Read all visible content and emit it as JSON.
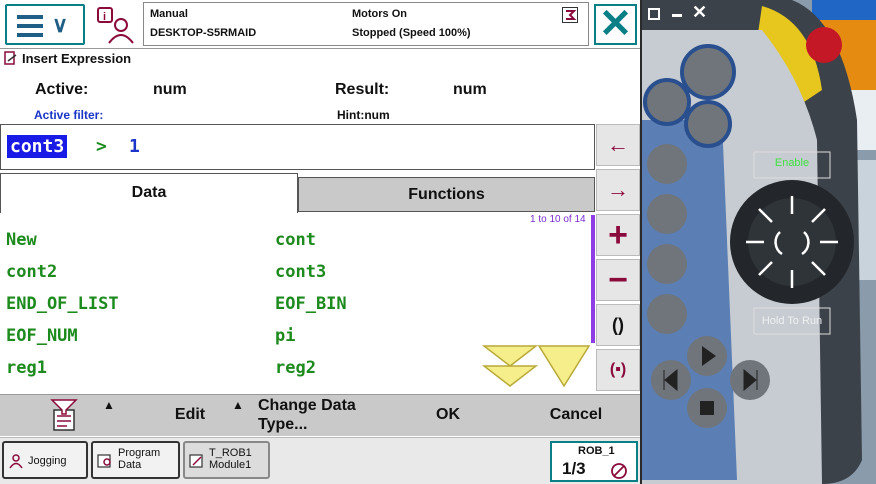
{
  "header": {
    "mode": "Manual",
    "system": "DESKTOP-S5RMAID",
    "motors": "Motors On",
    "state": "Stopped (Speed 100%)"
  },
  "dialog": {
    "title": "Insert Expression",
    "active_label": "Active:",
    "active_value": "num",
    "result_label": "Result:",
    "result_value": "num",
    "filter_label": "Active filter:",
    "hint": "Hint:num"
  },
  "expression": {
    "selected": "cont3",
    "operator": ">",
    "operand": "1"
  },
  "tabs": [
    {
      "label": "Data",
      "active": true
    },
    {
      "label": "Functions",
      "active": false
    }
  ],
  "list": {
    "range": "1 to 10 of 14",
    "items": [
      "New",
      "cont",
      "cont2",
      "cont3",
      "END_OF_LIST",
      "EOF_BIN",
      "EOF_NUM",
      "pi",
      "reg1",
      "reg2"
    ]
  },
  "side_buttons": [
    "←",
    "→",
    "+",
    "−",
    "()",
    "(▪)"
  ],
  "bottom_bar": {
    "edit": "Edit",
    "change_line1": "Change Data",
    "change_line2": "Type...",
    "ok": "OK",
    "cancel": "Cancel"
  },
  "taskbar": {
    "jogging": "Jogging",
    "program_line1": "Program",
    "program_line2": "Data",
    "task_line1": "T_ROB1",
    "task_line2": "Module1",
    "robot": "ROB_1",
    "fraction": "1/3"
  },
  "flexpendant": {
    "enable_label": "Enable",
    "hold_label": "Hold To Run"
  }
}
